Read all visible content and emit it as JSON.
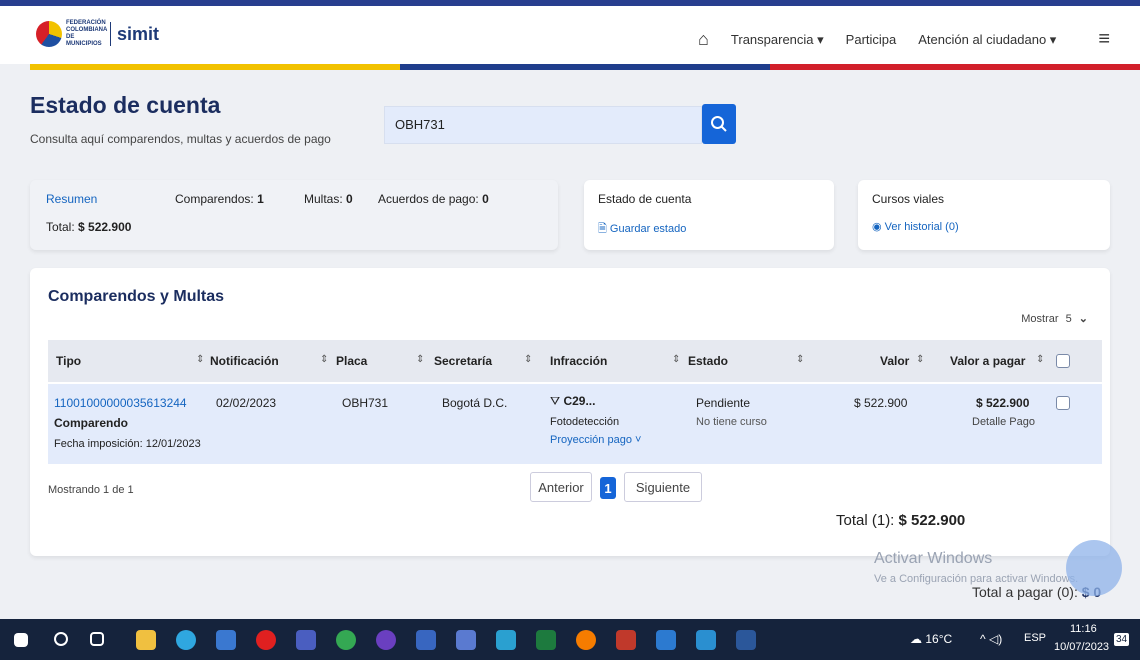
{
  "logo": {
    "federation": "FEDERACIÓN COLOMBIANA DE MUNICIPIOS",
    "brand": "simit"
  },
  "nav": {
    "items": [
      "Transparencia ▾",
      "Participa",
      "Atención al ciudadano ▾"
    ]
  },
  "colors": {
    "stripe": [
      "#f2c200",
      "#1f3d8c",
      "#d21f2a"
    ],
    "primary": "#1565d8",
    "title": "#1b2d5f"
  },
  "header": {
    "title": "Estado de cuenta",
    "subtitle": "Consulta aquí comparendos, multas y acuerdos de pago"
  },
  "search": {
    "value": "OBH731"
  },
  "summary": {
    "label": "Resumen",
    "total_label": "Total:",
    "total_value": "$ 522.900",
    "comparendos_label": "Comparendos:",
    "comparendos_value": "1",
    "multas_label": "Multas:",
    "multas_value": "0",
    "acuerdos_label": "Acuerdos de pago:",
    "acuerdos_value": "0"
  },
  "estado": {
    "title": "Estado de cuenta",
    "link": "Guardar estado"
  },
  "cursos": {
    "title": "Cursos viales",
    "link": "Ver historial (0)"
  },
  "table": {
    "title": "Comparendos y Multas",
    "mostrar_label": "Mostrar",
    "mostrar_value": "5",
    "headers": [
      "Tipo",
      "Notificación",
      "Placa",
      "Secretaría",
      "Infracción",
      "Estado",
      "Valor",
      "Valor a pagar"
    ],
    "row": {
      "numero": "11001000000035613244",
      "tipo": "Comparendo",
      "fecha": "Fecha imposición: 12/01/2023",
      "notificacion": "02/02/2023",
      "placa": "OBH731",
      "secretaria": "Bogotá D.C.",
      "infraccion": "C29...",
      "infraccion_detalle": "Fotodetección",
      "proyeccion": "Proyección pago ˅",
      "estado": "Pendiente",
      "estado_detalle": "No tiene curso",
      "valor": "$ 522.900",
      "valor_pagar": "$ 522.900",
      "detalle_pago": "Detalle Pago"
    },
    "mostrando": "Mostrando 1 de 1",
    "pagination": {
      "prev": "Anterior",
      "page": "1",
      "next": "Siguiente"
    },
    "total_label": "Total (1):",
    "total_value": "$ 522.900"
  },
  "overlay": {
    "activate_title": "Activar Windows",
    "activate_sub": "Ve a Configuración para activar Windows.",
    "total_pagar_label": "Total a pagar (0):",
    "total_pagar_value": "$ 0"
  },
  "taskbar": {
    "temperature": "16°C",
    "language": "ESP",
    "time": "11:16",
    "date": "10/07/2023",
    "notifications": "34"
  }
}
